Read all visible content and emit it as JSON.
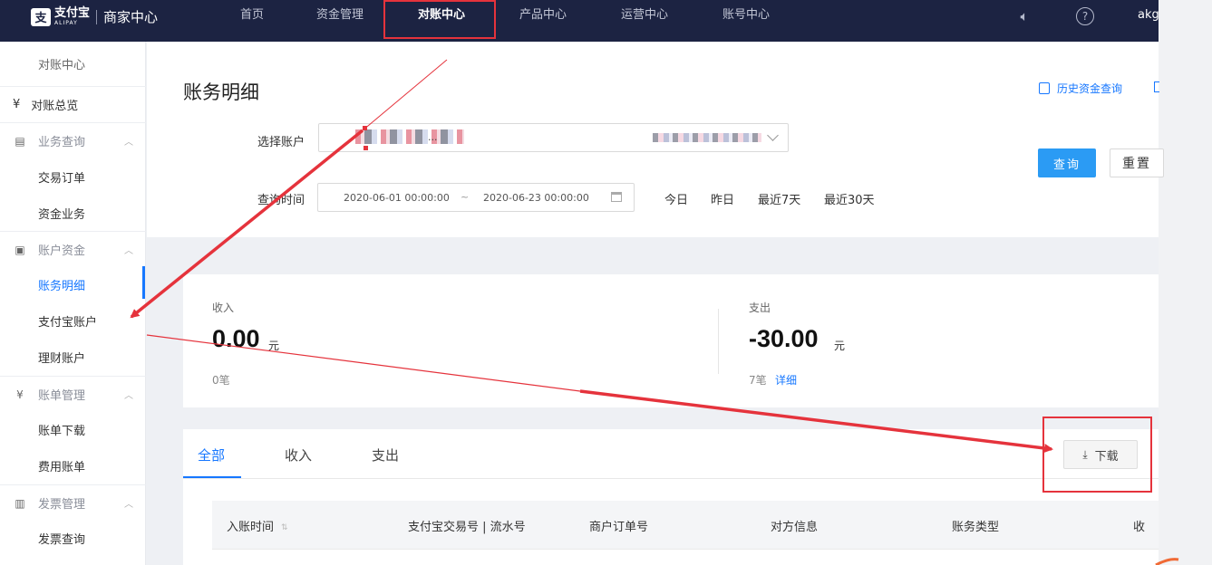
{
  "header": {
    "logo_icon": "支",
    "logo_text": "支付宝",
    "logo_sub": "ALIPAY",
    "app_title": "商家中心",
    "nav": [
      "首页",
      "资金管理",
      "对账中心",
      "产品中心",
      "运营中心",
      "账号中心"
    ],
    "user": "akg"
  },
  "sidebar": {
    "heading": "对账中心",
    "overview": "对账总览",
    "groups": [
      {
        "label": "业务查询",
        "items": [
          "交易订单",
          "资金业务"
        ]
      },
      {
        "label": "账户资金",
        "items": [
          "账务明细",
          "支付宝账户",
          "理财账户"
        ]
      },
      {
        "label": "账单管理",
        "items": [
          "账单下载",
          "费用账单"
        ]
      },
      {
        "label": "发票管理",
        "items": [
          "发票查询"
        ]
      }
    ]
  },
  "main": {
    "title": "账务明细",
    "history_link": "历史资金查询",
    "account_label": "选择账户",
    "account_text_1": "...",
    "account_text_2": "...",
    "time_label": "查询时间",
    "date_start": "2020-06-01 00:00:00",
    "date_sep": "~",
    "date_end": "2020-06-23 00:00:00",
    "quick_ranges": [
      "今日",
      "昨日",
      "最近7天",
      "最近30天"
    ],
    "query_button": "查询",
    "reset_button": "重置"
  },
  "stats": {
    "income_label": "收入",
    "income_value": "0.00",
    "income_unit": "元",
    "income_count": "0笔",
    "expense_label": "支出",
    "expense_value": "-30.00",
    "expense_unit": "元",
    "expense_count": "7笔",
    "detail_link": "详细"
  },
  "table": {
    "tabs": [
      "全部",
      "收入",
      "支出"
    ],
    "download_button": "下载",
    "columns": [
      "入账时间",
      "支付宝交易号 | 流水号",
      "商户订单号",
      "对方信息",
      "账务类型",
      "收"
    ]
  },
  "colors": {
    "nav_bg": "#1c2342",
    "accent_blue": "#1677ff",
    "annotation_red": "#e5333c"
  }
}
